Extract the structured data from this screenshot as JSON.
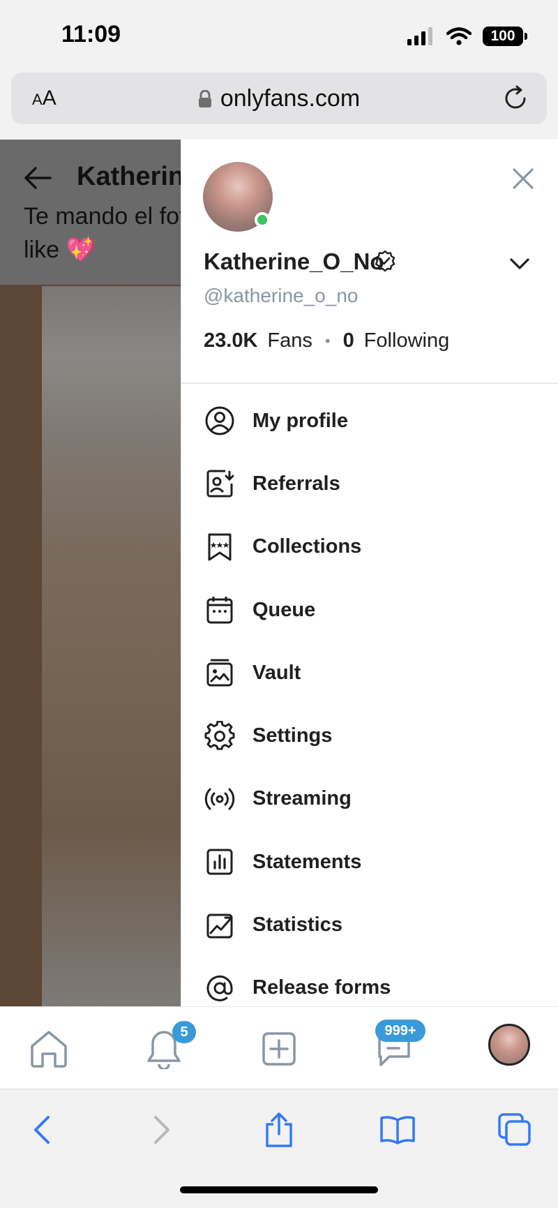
{
  "status_bar": {
    "time": "11:09",
    "battery": "100"
  },
  "browser": {
    "text_size_button": "AA",
    "url": "onlyfans.com"
  },
  "background_page": {
    "title": "Katherin",
    "post_text_line1": "Te mando el fot",
    "post_text_line2": "like 💖"
  },
  "profile": {
    "display_name": "Katherine_O_No",
    "handle": "@katherine_o_no",
    "fans_count": "23.0K",
    "fans_label": "Fans",
    "following_count": "0",
    "following_label": "Following"
  },
  "menu": {
    "items": [
      {
        "label": "My profile",
        "icon": "profile-icon"
      },
      {
        "label": "Referrals",
        "icon": "referrals-icon"
      },
      {
        "label": "Collections",
        "icon": "collections-icon"
      },
      {
        "label": "Queue",
        "icon": "calendar-icon"
      },
      {
        "label": "Vault",
        "icon": "vault-icon"
      },
      {
        "label": "Settings",
        "icon": "gear-icon"
      },
      {
        "label": "Streaming",
        "icon": "streaming-icon"
      },
      {
        "label": "Statements",
        "icon": "statements-icon"
      },
      {
        "label": "Statistics",
        "icon": "statistics-icon"
      },
      {
        "label": "Release forms",
        "icon": "at-icon"
      }
    ]
  },
  "tab_bar": {
    "notifications_badge": "5",
    "messages_badge": "999+"
  },
  "colors": {
    "accent": "#3a9ad9",
    "online": "#3cc267",
    "muted_text": "#8a96a3",
    "icon_gray": "#8a96a3"
  }
}
